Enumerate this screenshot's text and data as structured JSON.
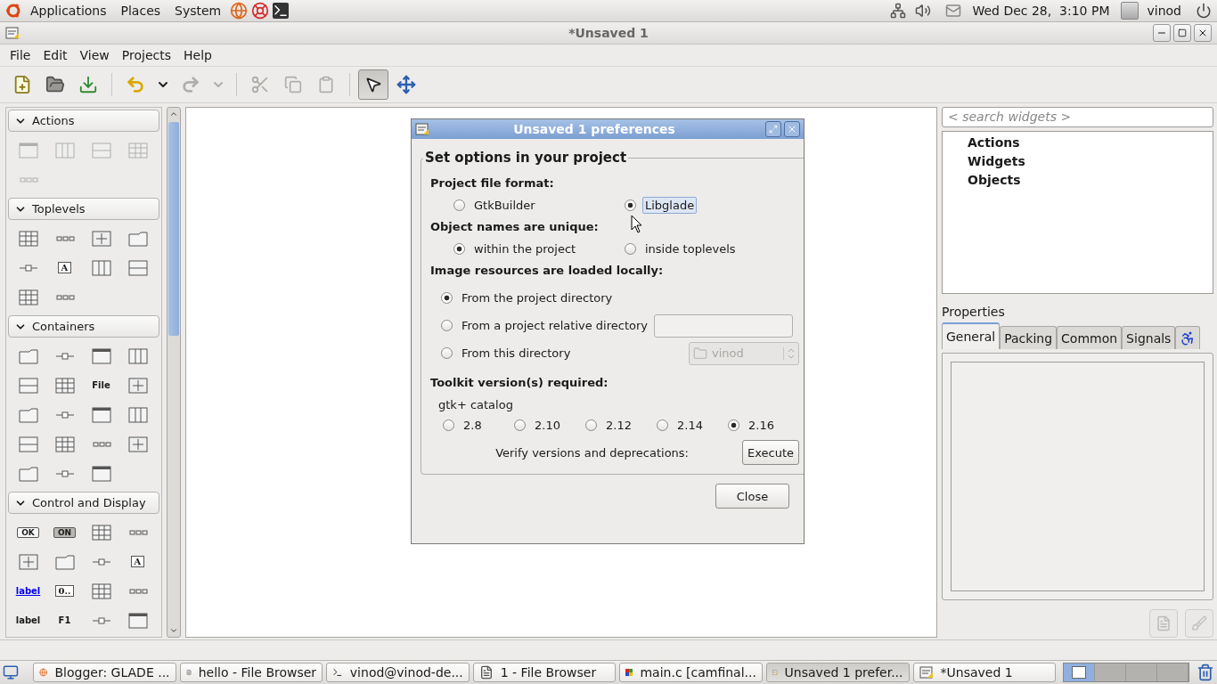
{
  "top_panel": {
    "menus": [
      "Applications",
      "Places",
      "System"
    ],
    "clock": "Wed Dec 28,  3:10 PM",
    "user": "vinod"
  },
  "window": {
    "title": "*Unsaved 1"
  },
  "menubar": [
    "File",
    "Edit",
    "View",
    "Projects",
    "Help"
  ],
  "toolbar": [
    {
      "kind": "new",
      "disabled": false
    },
    {
      "kind": "open",
      "disabled": false
    },
    {
      "kind": "save",
      "disabled": false
    },
    {
      "kind": "separator"
    },
    {
      "kind": "undo",
      "disabled": false
    },
    {
      "kind": "menu",
      "disabled": false
    },
    {
      "kind": "redo",
      "disabled": true
    },
    {
      "kind": "menu",
      "disabled": true
    },
    {
      "kind": "separator"
    },
    {
      "kind": "cut",
      "disabled": true
    },
    {
      "kind": "copy",
      "disabled": true
    },
    {
      "kind": "paste",
      "disabled": true
    },
    {
      "kind": "separator"
    },
    {
      "kind": "select",
      "selected": true
    },
    {
      "kind": "drag",
      "selected": false
    }
  ],
  "palette": {
    "groups": [
      {
        "title": "Actions",
        "expanded": true,
        "disabled": true,
        "items": [
          {
            "kind": "icon"
          },
          {
            "kind": "icon"
          },
          {
            "kind": "icon"
          },
          {
            "kind": "icon"
          },
          {
            "kind": "icon"
          }
        ]
      },
      {
        "title": "Toplevels",
        "expanded": true,
        "disabled": false,
        "items": [
          {
            "kind": "icon"
          },
          {
            "kind": "icon"
          },
          {
            "kind": "icon"
          },
          {
            "kind": "icon"
          },
          {
            "kind": "icon"
          },
          {
            "kind": "boxed",
            "text": "A"
          },
          {
            "kind": "icon"
          },
          {
            "kind": "icon"
          },
          {
            "kind": "icon"
          },
          {
            "kind": "icon"
          }
        ]
      },
      {
        "title": "Containers",
        "expanded": true,
        "disabled": false,
        "items": [
          {
            "kind": "icon"
          },
          {
            "kind": "icon"
          },
          {
            "kind": "icon"
          },
          {
            "kind": "icon"
          },
          {
            "kind": "icon"
          },
          {
            "kind": "icon"
          },
          {
            "kind": "label",
            "text": "File"
          },
          {
            "kind": "icon"
          },
          {
            "kind": "icon"
          },
          {
            "kind": "icon"
          },
          {
            "kind": "icon"
          },
          {
            "kind": "icon"
          },
          {
            "kind": "icon"
          },
          {
            "kind": "icon"
          },
          {
            "kind": "icon"
          },
          {
            "kind": "icon"
          },
          {
            "kind": "icon"
          },
          {
            "kind": "icon"
          },
          {
            "kind": "icon"
          }
        ]
      },
      {
        "title": "Control and Display",
        "expanded": true,
        "disabled": false,
        "items": [
          {
            "kind": "button",
            "text": "OK"
          },
          {
            "kind": "toggle",
            "text": "ON"
          },
          {
            "kind": "icon"
          },
          {
            "kind": "icon"
          },
          {
            "kind": "icon"
          },
          {
            "kind": "icon"
          },
          {
            "kind": "icon"
          },
          {
            "kind": "boxed",
            "text": "A"
          },
          {
            "kind": "link",
            "text": "label"
          },
          {
            "kind": "boxed",
            "text": "0.."
          },
          {
            "kind": "icon"
          },
          {
            "kind": "icon"
          },
          {
            "kind": "label",
            "text": "label"
          },
          {
            "kind": "label",
            "text": "F1"
          },
          {
            "kind": "icon"
          },
          {
            "kind": "icon"
          }
        ]
      }
    ]
  },
  "dialog": {
    "title": "Unsaved 1 preferences",
    "frame_title": "Set options in your project",
    "file_format": {
      "heading": "Project file format:",
      "options": [
        {
          "label": "GtkBuilder",
          "selected": false,
          "focused": false
        },
        {
          "label": "Libglade",
          "selected": true,
          "focused": true
        }
      ]
    },
    "object_names": {
      "heading": "Object names are unique:",
      "options": [
        {
          "label": "within the project",
          "selected": true
        },
        {
          "label": "inside toplevels",
          "selected": false
        }
      ]
    },
    "image_resources": {
      "heading": "Image resources are loaded locally:",
      "options": [
        {
          "label": "From the project directory",
          "selected": true,
          "kind": "plain"
        },
        {
          "label": "From a project relative directory",
          "selected": false,
          "kind": "entry"
        },
        {
          "label": "From this directory",
          "selected": false,
          "kind": "chooser",
          "value": "vinod",
          "disabled": true
        }
      ]
    },
    "toolkit": {
      "heading": "Toolkit version(s) required:",
      "catalog": "gtk+ catalog",
      "versions": [
        {
          "label": "2.8",
          "selected": false
        },
        {
          "label": "2.10",
          "selected": false
        },
        {
          "label": "2.12",
          "selected": false
        },
        {
          "label": "2.14",
          "selected": false
        },
        {
          "label": "2.16",
          "selected": true
        }
      ],
      "verify_label": "Verify versions and deprecations:",
      "execute_button": "Execute"
    },
    "close_button": "Close"
  },
  "inspector": {
    "search_placeholder": "< search widgets >",
    "tree": [
      "Actions",
      "Widgets",
      "Objects"
    ]
  },
  "properties": {
    "title": "Properties",
    "tabs": [
      {
        "kind": "text",
        "label": "General",
        "selected": true
      },
      {
        "kind": "text",
        "label": "Packing",
        "selected": false
      },
      {
        "kind": "text",
        "label": "Common",
        "selected": false
      },
      {
        "kind": "text",
        "label": "Signals",
        "selected": false
      },
      {
        "kind": "accessibility",
        "selected": false
      }
    ],
    "buttons": [
      {
        "kind": "docs",
        "disabled": true
      },
      {
        "kind": "clear",
        "disabled": true
      }
    ]
  },
  "taskbar": {
    "items": [
      {
        "kind": "browser",
        "label": "Blogger: GLADE ...",
        "selected": false
      },
      {
        "kind": "folder",
        "label": "hello - File Browser",
        "selected": false
      },
      {
        "kind": "terminal",
        "label": "vinod@vinod-de...",
        "selected": false
      },
      {
        "kind": "folder",
        "label": "1 - File Browser",
        "selected": false
      },
      {
        "kind": "editor",
        "label": "main.c [camfinal...",
        "selected": false
      },
      {
        "kind": "glade",
        "label": "Unsaved 1 prefer...",
        "selected": true
      },
      {
        "kind": "glade",
        "label": "*Unsaved 1",
        "selected": false
      }
    ],
    "workspaces": [
      {
        "selected": true
      },
      {
        "selected": false
      },
      {
        "selected": false
      },
      {
        "selected": false
      }
    ]
  }
}
